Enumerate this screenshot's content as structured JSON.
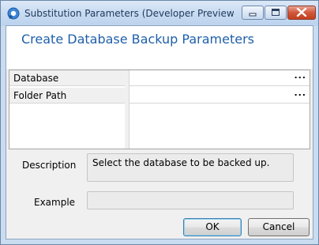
{
  "window": {
    "title": "Substitution Parameters (Developer Preview - N...",
    "icons": {
      "app": "app-icon",
      "minimize": "minimize-icon",
      "maximize": "maximize-icon",
      "close": "close-icon"
    }
  },
  "header": {
    "title": "Create Database Backup Parameters"
  },
  "grid": {
    "rows": [
      {
        "name": "Database",
        "value": "",
        "button": "..."
      },
      {
        "name": "Folder Path",
        "value": "",
        "button": "..."
      }
    ]
  },
  "description": {
    "label": "Description",
    "text": "Select the database to be backed up."
  },
  "example": {
    "label": "Example",
    "text": ""
  },
  "buttons": {
    "ok": "OK",
    "cancel": "Cancel"
  }
}
